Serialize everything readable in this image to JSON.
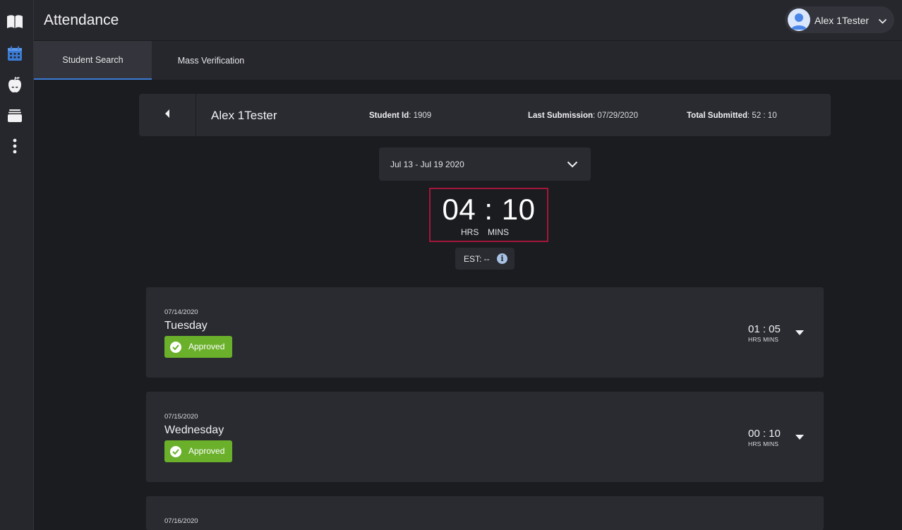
{
  "app": {
    "title": "Attendance"
  },
  "user": {
    "name": "Alex 1Tester"
  },
  "sidebar": {
    "items": [
      {
        "icon": "book-icon"
      },
      {
        "icon": "calendar-icon",
        "active": true
      },
      {
        "icon": "apple-icon"
      },
      {
        "icon": "archive-icon"
      },
      {
        "icon": "more-vertical-icon"
      }
    ]
  },
  "tabs": [
    {
      "label": "Student Search",
      "active": true
    },
    {
      "label": "Mass Verification",
      "active": false
    }
  ],
  "student": {
    "name": "Alex 1Tester",
    "id_label": "Student Id",
    "id_value": "1909",
    "last_label": "Last Submission",
    "last_value": "07/29/2020",
    "total_label": "Total Submitted",
    "total_value": "52 : 10"
  },
  "week": {
    "label": "Jul 13 - Jul 19 2020"
  },
  "total": {
    "time": "04 : 10",
    "hrs_label": "HRS",
    "mins_label": "MINS"
  },
  "est": {
    "label": "EST: --"
  },
  "days": [
    {
      "date": "07/14/2020",
      "day": "Tuesday",
      "status": "Approved",
      "time": "01 : 05",
      "units": "HRS MINS"
    },
    {
      "date": "07/15/2020",
      "day": "Wednesday",
      "status": "Approved",
      "time": "00 : 10",
      "units": "HRS MINS"
    },
    {
      "date": "07/16/2020"
    }
  ],
  "colors": {
    "accent": "#3a7bd5",
    "approved": "#6ab02b",
    "total_border": "#a3163a"
  }
}
